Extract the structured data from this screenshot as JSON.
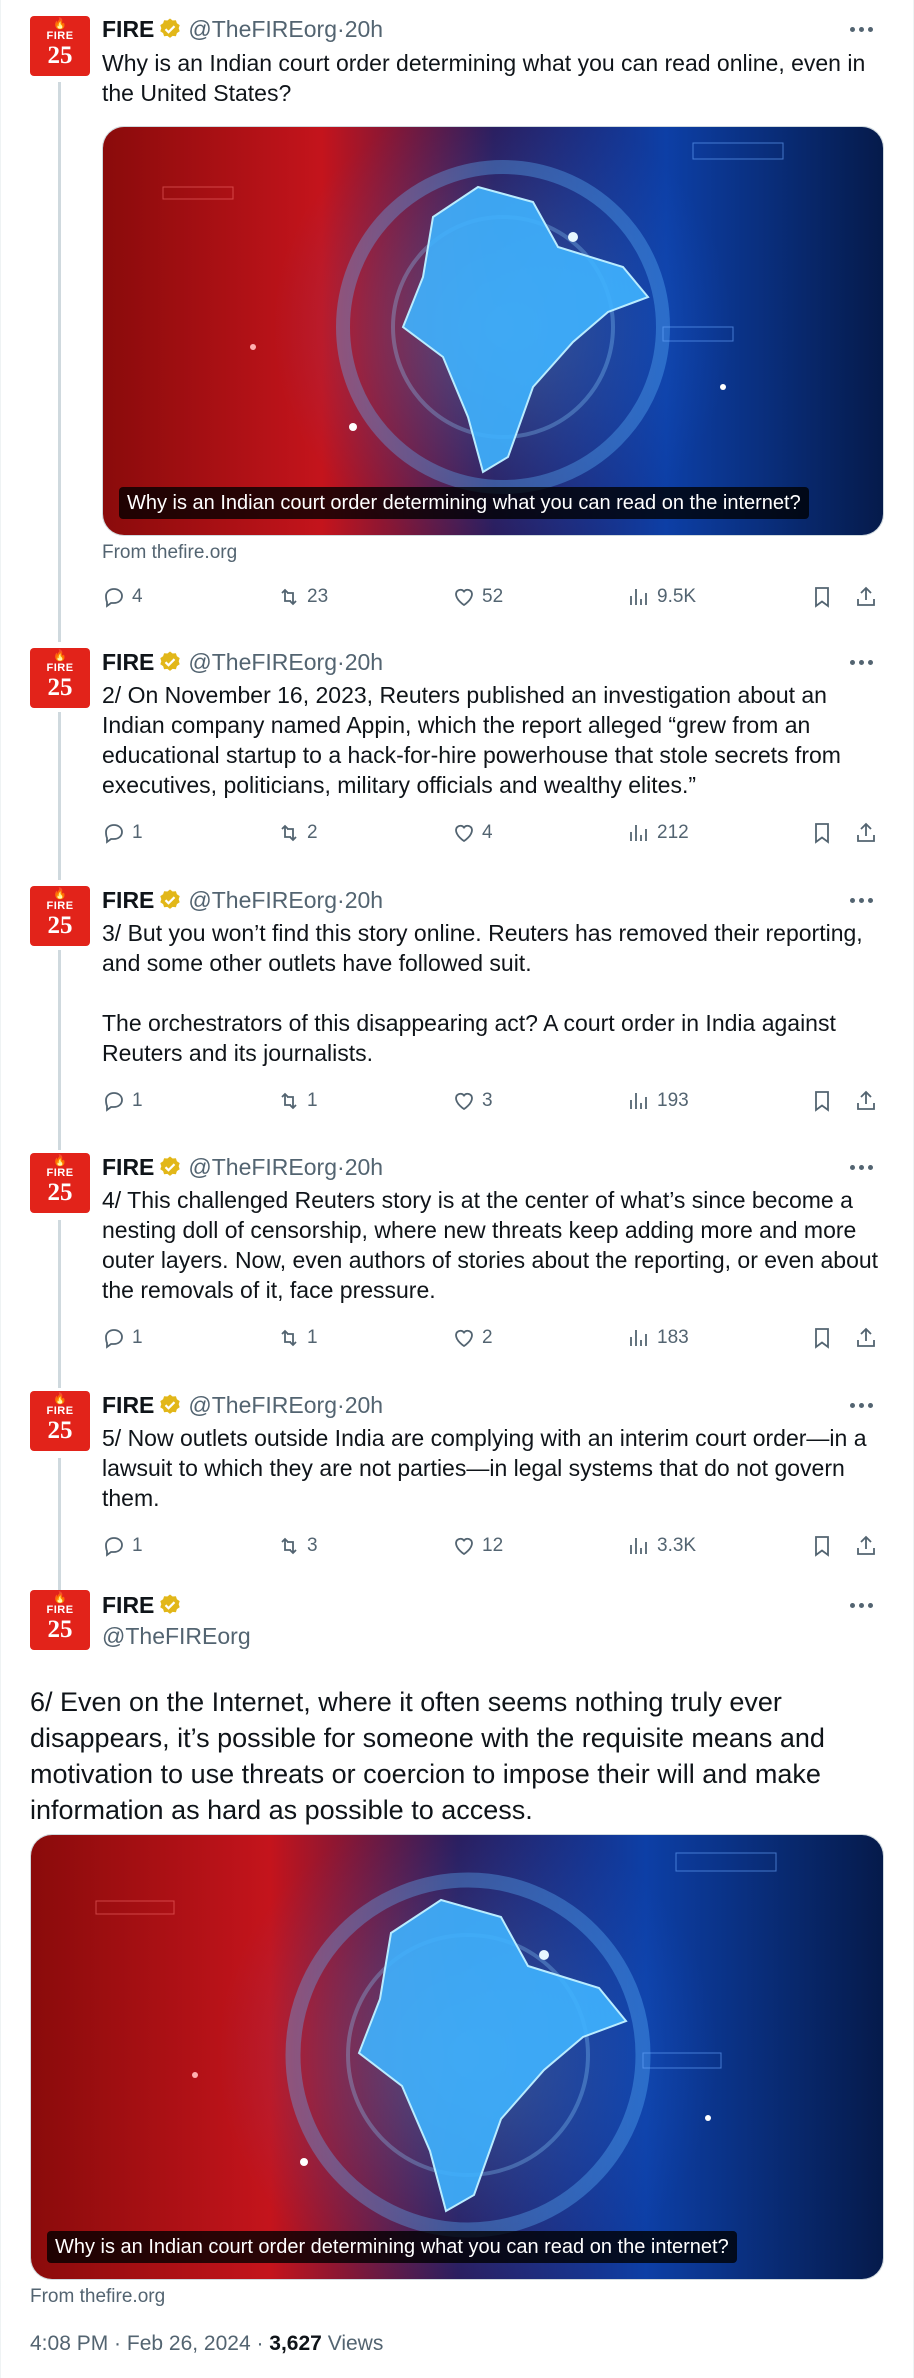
{
  "author": {
    "name": "FIRE",
    "handle": "@TheFIREorg",
    "avatar_label": "FIRE",
    "avatar_number": "25",
    "verified_color": "#e2b719"
  },
  "tweets": [
    {
      "time": "20h",
      "text": "Why is an Indian court order determining what you can read online, even in the United States?",
      "card": {
        "caption": "Why is an Indian court order determining what you can read on the internet?",
        "source": "From thefire.org"
      },
      "replies": "4",
      "reposts": "23",
      "likes": "52",
      "views": "9.5K"
    },
    {
      "time": "20h",
      "text": "2/ On November 16, 2023, Reuters published an investigation about an Indian company named Appin, which the report alleged “grew from an educational startup to a hack-for-hire powerhouse that stole secrets from executives, politicians, military officials and wealthy elites.”",
      "replies": "1",
      "reposts": "2",
      "likes": "4",
      "views": "212"
    },
    {
      "time": "20h",
      "text": "3/ But you won’t find this story online. Reuters has removed their reporting, and some other outlets have followed suit.\n\nThe orchestrators of this disappearing act? A court order in India against Reuters and its journalists.",
      "replies": "1",
      "reposts": "1",
      "likes": "3",
      "views": "193"
    },
    {
      "time": "20h",
      "text": "4/ This challenged Reuters story is at the center of what’s since become a nesting doll of censorship, where new threats keep adding more and more outer layers. Now, even authors of stories about the reporting, or even about the removals of it, face pressure.",
      "replies": "1",
      "reposts": "1",
      "likes": "2",
      "views": "183"
    },
    {
      "time": "20h",
      "text": "5/ Now outlets outside India are complying with an interim court order—in a lawsuit to which they are not parties—in legal systems that do not govern them.",
      "replies": "1",
      "reposts": "3",
      "likes": "12",
      "views": "3.3K"
    }
  ],
  "main": {
    "text": "6/ Even on the Internet, where it often seems nothing truly ever disappears, it’s possible for someone with the requisite means and motivation to use threats or coercion to impose their will and make information as hard as possible to access.",
    "card": {
      "caption": "Why is an Indian court order determining what you can read on the internet?",
      "source": "From thefire.org"
    },
    "timestamp": "4:08 PM · Feb 26, 2024 · ",
    "views_count": "3,627",
    "views_label": " Views"
  },
  "separator": " · ",
  "colors": {
    "accent_red": "#e2231a",
    "muted": "#536471",
    "text": "#0f1419",
    "thread_line": "#cfd9de"
  }
}
